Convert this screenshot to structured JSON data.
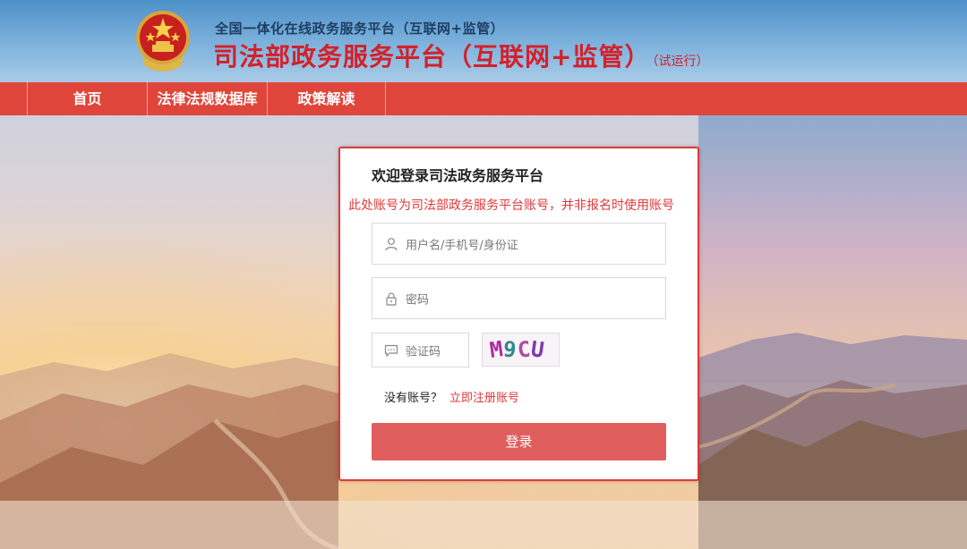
{
  "header": {
    "subtitle": "全国一体化在线政务服务平台（互联网+监管）",
    "title": "司法部政务服务平台（互联网+监管）",
    "title_tag": "（试运行）",
    "emblem_icon": "national-emblem-icon"
  },
  "nav": {
    "items": [
      {
        "label": "首页"
      },
      {
        "label": "法律法规数据库"
      },
      {
        "label": "政策解读"
      }
    ]
  },
  "login": {
    "title": "欢迎登录司法政务服务平台",
    "note": "此处账号为司法部政务服务平台账号，并非报名时使用账号",
    "username_placeholder": "用户名/手机号/身份证",
    "password_placeholder": "密码",
    "captcha_placeholder": "验证码",
    "captcha_value": "M9CU",
    "no_account_text": "没有账号？",
    "register_link": "立即注册账号",
    "submit_label": "登录"
  },
  "colors": {
    "brand_red": "#e0453b",
    "title_red": "#d4202a",
    "button_red": "#e05f5e",
    "header_blue": "#4d90c9"
  }
}
